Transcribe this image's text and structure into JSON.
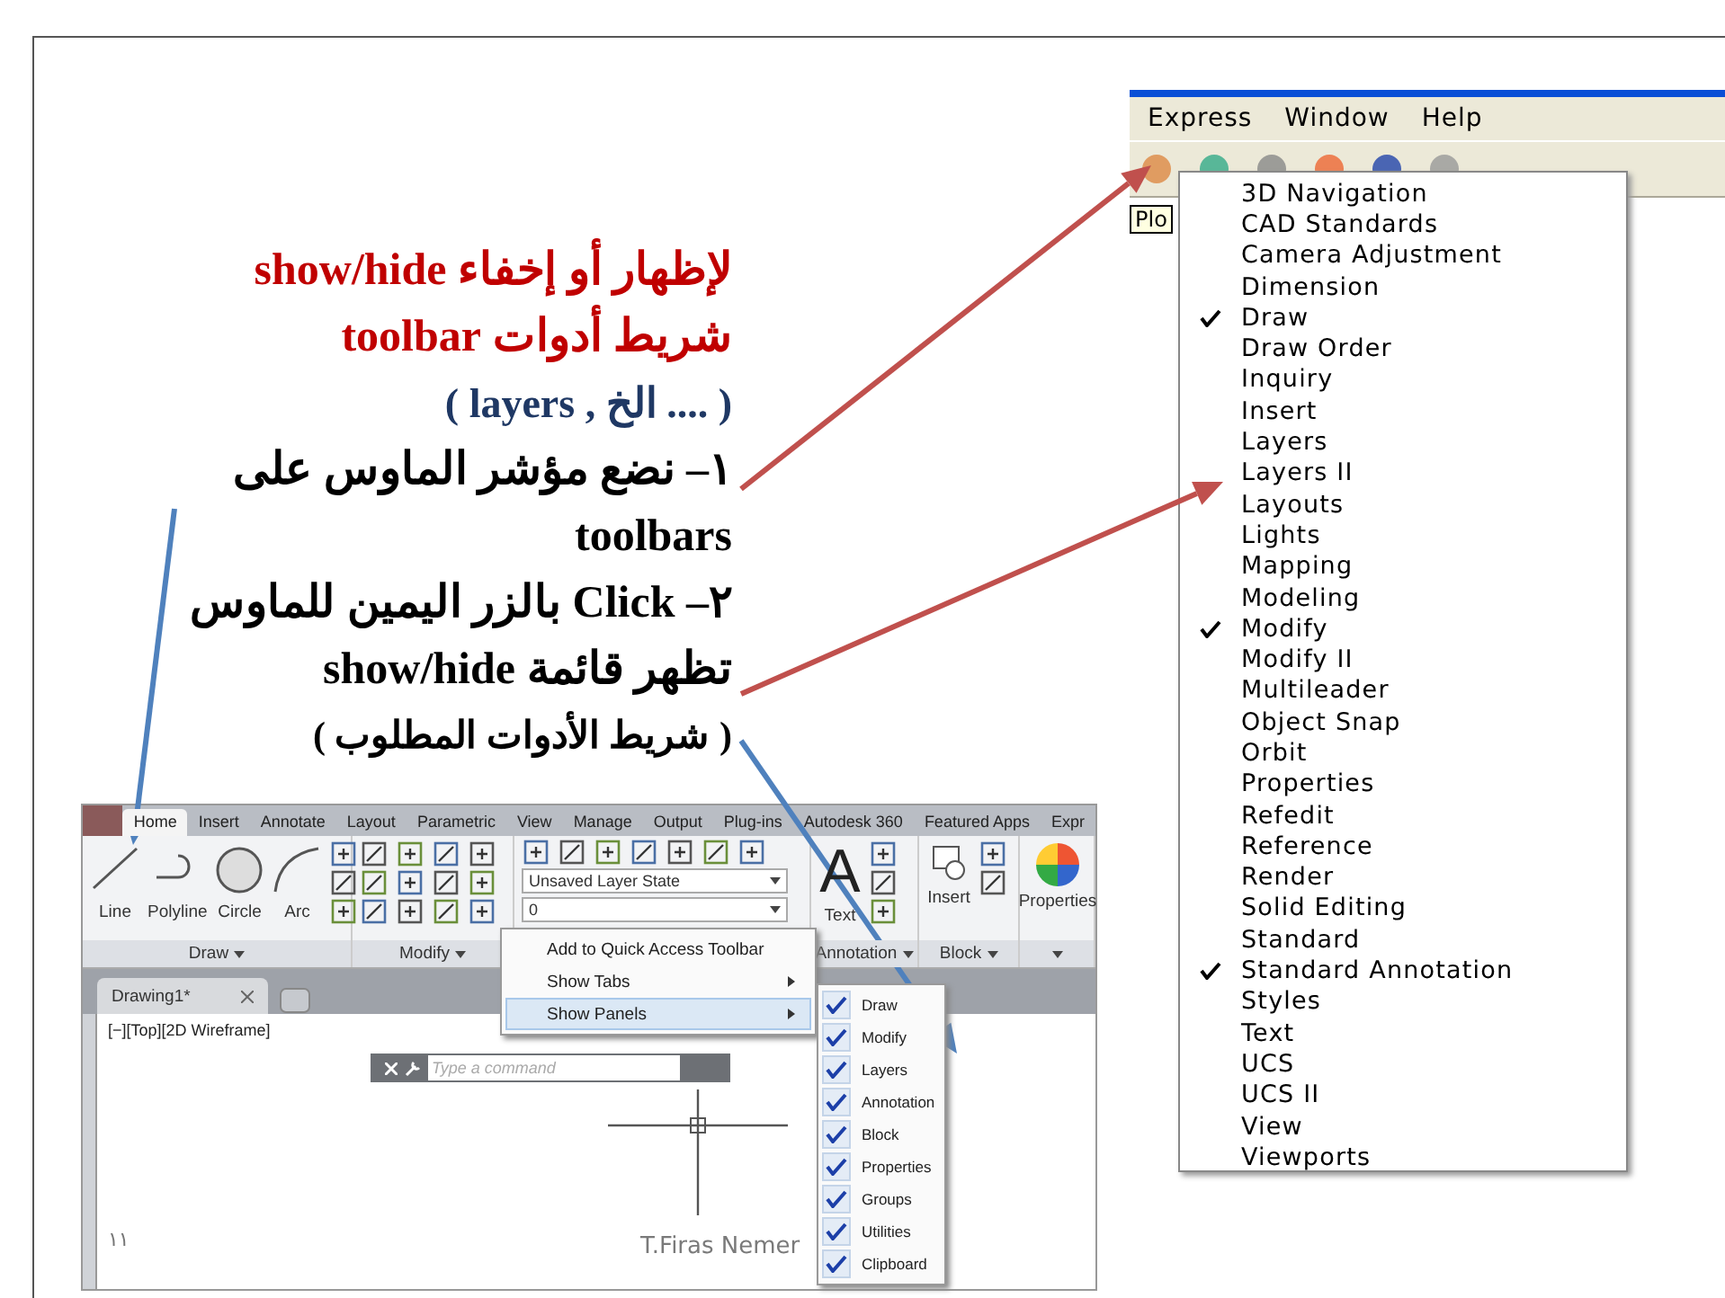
{
  "slide": {
    "number": "١١",
    "footer": "T.Firas Nemer"
  },
  "instructions": [
    {
      "kind": "heading",
      "text": "لإظهار أو إخفاء show/hide شريط أدوات toolbar"
    },
    {
      "kind": "note",
      "text": "( .... الخ , layers )"
    },
    {
      "kind": "step",
      "text": "١– نضع مؤشر الماوس على toolbars"
    },
    {
      "kind": "step",
      "text": "٢–  Click بالزر اليمين للماوس تظهر قائمة show/hide"
    },
    {
      "kind": "remark",
      "text": "( شريط الأدوات المطلوب )"
    }
  ],
  "menu_window": {
    "menus": [
      "Express",
      "Window",
      "Help"
    ],
    "tooltip": "Plo",
    "toolbar_menu": [
      {
        "label": "3D Navigation",
        "checked": false
      },
      {
        "label": "CAD Standards",
        "checked": false
      },
      {
        "label": "Camera Adjustment",
        "checked": false
      },
      {
        "label": "Dimension",
        "checked": false
      },
      {
        "label": "Draw",
        "checked": true
      },
      {
        "label": "Draw Order",
        "checked": false
      },
      {
        "label": "Inquiry",
        "checked": false
      },
      {
        "label": "Insert",
        "checked": false
      },
      {
        "label": "Layers",
        "checked": false
      },
      {
        "label": "Layers II",
        "checked": false
      },
      {
        "label": "Layouts",
        "checked": false
      },
      {
        "label": "Lights",
        "checked": false
      },
      {
        "label": "Mapping",
        "checked": false
      },
      {
        "label": "Modeling",
        "checked": false
      },
      {
        "label": "Modify",
        "checked": true
      },
      {
        "label": "Modify II",
        "checked": false
      },
      {
        "label": "Multileader",
        "checked": false
      },
      {
        "label": "Object Snap",
        "checked": false
      },
      {
        "label": "Orbit",
        "checked": false
      },
      {
        "label": "Properties",
        "checked": false
      },
      {
        "label": "Refedit",
        "checked": false
      },
      {
        "label": "Reference",
        "checked": false
      },
      {
        "label": "Render",
        "checked": false
      },
      {
        "label": "Solid Editing",
        "checked": false
      },
      {
        "label": "Standard",
        "checked": false
      },
      {
        "label": "Standard Annotation",
        "checked": true
      },
      {
        "label": "Styles",
        "checked": false
      },
      {
        "label": "Text",
        "checked": false
      },
      {
        "label": "UCS",
        "checked": false
      },
      {
        "label": "UCS II",
        "checked": false
      },
      {
        "label": "View",
        "checked": false
      },
      {
        "label": "Viewports",
        "checked": false
      }
    ]
  },
  "ribbon_window": {
    "tabs": [
      {
        "label": "Home",
        "selected": true
      },
      {
        "label": "Insert",
        "selected": false
      },
      {
        "label": "Annotate",
        "selected": false
      },
      {
        "label": "Layout",
        "selected": false
      },
      {
        "label": "Parametric",
        "selected": false
      },
      {
        "label": "View",
        "selected": false
      },
      {
        "label": "Manage",
        "selected": false
      },
      {
        "label": "Output",
        "selected": false
      },
      {
        "label": "Plug-ins",
        "selected": false
      },
      {
        "label": "Autodesk 360",
        "selected": false
      },
      {
        "label": "Featured Apps",
        "selected": false
      },
      {
        "label": "Expr",
        "selected": false
      }
    ],
    "draw_panel": {
      "title": "Draw",
      "tools": [
        "Line",
        "Polyline",
        "Circle",
        "Arc"
      ]
    },
    "modify_panel": {
      "title": "Modify"
    },
    "layers_panel": {
      "layer_state": "Unsaved Layer State",
      "current_layer": "0"
    },
    "annotation_panel": {
      "title": "Annotation",
      "glyph": "A",
      "tool": "Text"
    },
    "block_panel": {
      "title": "Block",
      "tool": "Insert"
    },
    "properties_panel": {
      "tool": "Properties"
    },
    "document_tab": "Drawing1*",
    "viewport_label": "[−][Top][2D Wireframe]",
    "command_placeholder": "Type a command",
    "context_menu": [
      {
        "label": "Add to Quick Access Toolbar",
        "has_submenu": false,
        "selected": false
      },
      {
        "label": "Show Tabs",
        "has_submenu": true,
        "selected": false
      },
      {
        "label": "Show Panels",
        "has_submenu": true,
        "selected": true
      }
    ],
    "panels_submenu": [
      {
        "label": "Draw",
        "checked": true
      },
      {
        "label": "Modify",
        "checked": true
      },
      {
        "label": "Layers",
        "checked": true
      },
      {
        "label": "Annotation",
        "checked": true
      },
      {
        "label": "Block",
        "checked": true
      },
      {
        "label": "Properties",
        "checked": true
      },
      {
        "label": "Groups",
        "checked": true
      },
      {
        "label": "Utilities",
        "checked": true
      },
      {
        "label": "Clipboard",
        "checked": true
      }
    ]
  }
}
